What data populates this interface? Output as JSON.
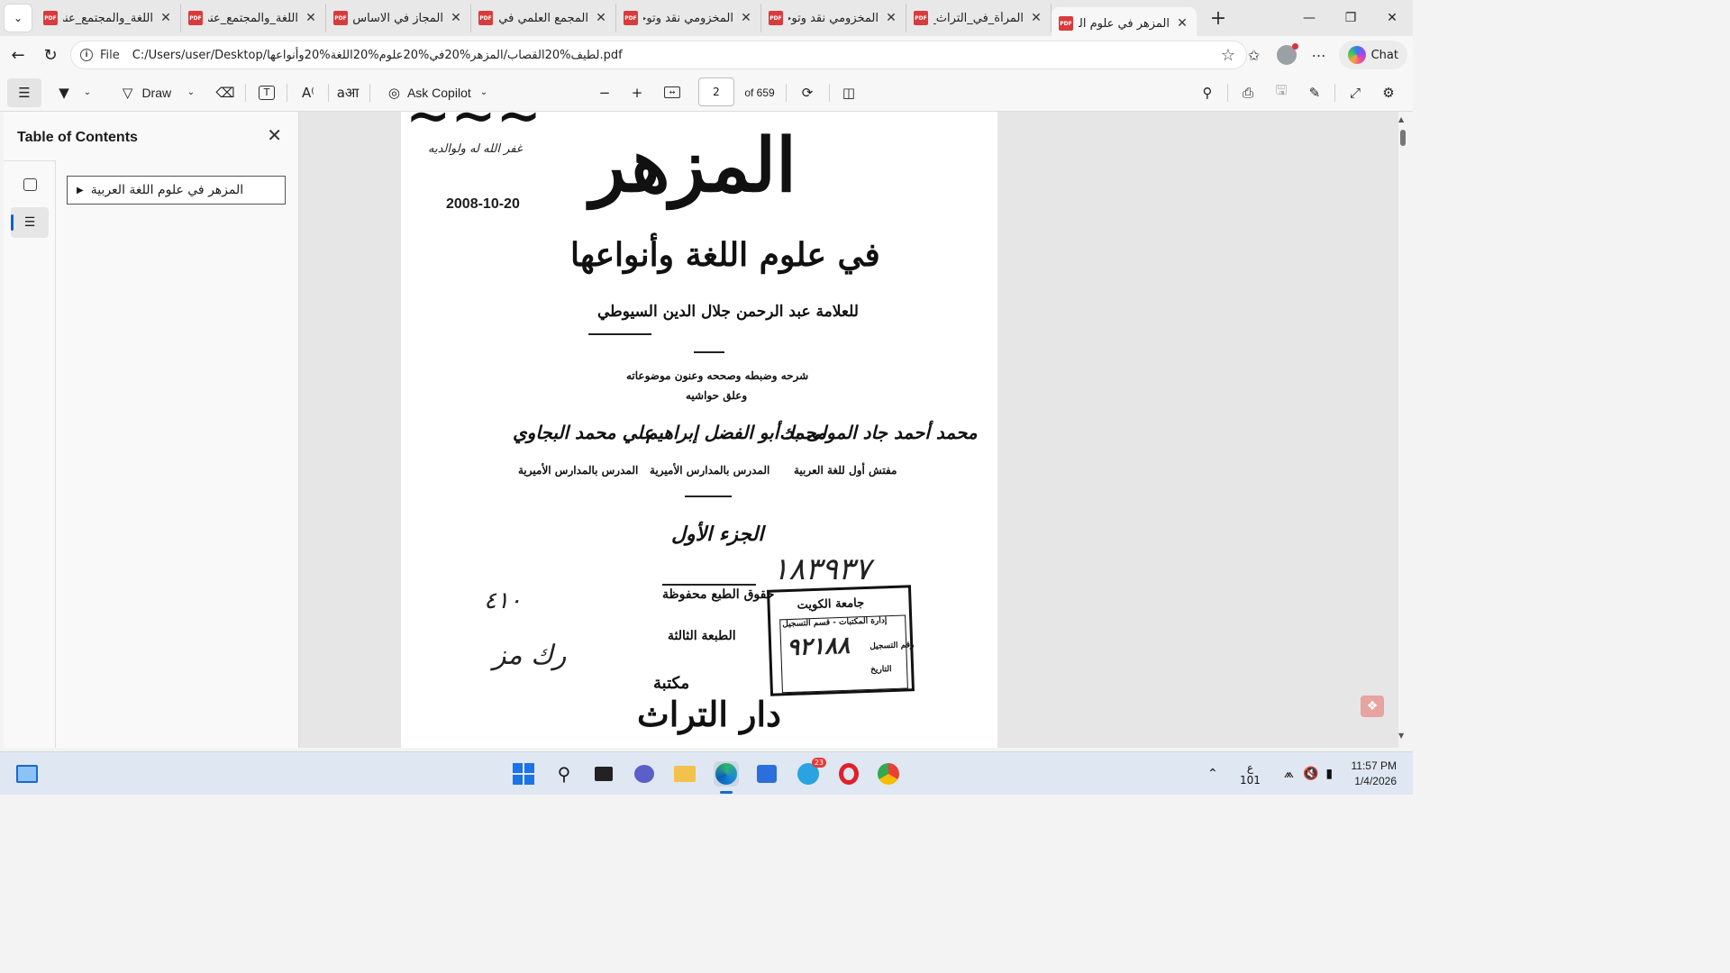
{
  "tabs": [
    {
      "title": "اللغة_والمجتمع_عند",
      "active": false
    },
    {
      "title": "اللغة_والمجتمع_عند",
      "active": false
    },
    {
      "title": "المجاز في الاساس.pdf",
      "active": false
    },
    {
      "title": "المجمع العلمي في ال",
      "active": false
    },
    {
      "title": "المخزومي نقد وتوجيه",
      "active": false
    },
    {
      "title": "المخزومي نقد وتوجيه",
      "active": false
    },
    {
      "title": "المرأة_في_التراث_الع",
      "active": false
    },
    {
      "title": "المزهر في علوم اللغ",
      "active": true
    }
  ],
  "address": {
    "scheme_label": "File",
    "url": "C:/Users/user/Desktop/لطيف%20القصاب/المزهر%20في%20علوم%20اللغة%20وأنواعها.pdf"
  },
  "chat_label": "Chat",
  "pdf_toolbar": {
    "draw_label": "Draw",
    "ask_copilot_label": "Ask Copilot",
    "page_current": "2",
    "page_total": "of 659"
  },
  "sidebar": {
    "title": "Table of Contents",
    "toc_items": [
      "المزهر في علوم اللغة العربية"
    ]
  },
  "page": {
    "title": "المزهر",
    "dedication": "غفر الله له ولوالديه",
    "date": "2008-10-20",
    "subtitle": "في علوم اللغة وأنواعها",
    "author": "للعلامة عبد الرحمن جلال الدين السيوطي",
    "editors_line1": "شرحه وضبطه وصححه وعنون موضوعاته",
    "editors_line2": "وعلق حواشيه",
    "editor1_name": "محمد أحمد جاد المولى بك",
    "editor1_role": "مفتش أول للغة العربية",
    "editor2_name": "محمد أبو الفضل إبراهيم",
    "editor2_role": "المدرس بالمدارس الأميرية",
    "editor3_name": "علي محمد البجاوي",
    "editor3_role": "المدرس بالمدارس الأميرية",
    "volume": "الجزء الأول",
    "handwritten_number": "١٨٣٩٣٧",
    "handwritten_note1": "٤١٠",
    "handwritten_note2": "رك مز",
    "copyright": "حقوق الطبع محفوظة",
    "edition": "الطبعة الثالثة",
    "stamp_university": "جامعة الكويت",
    "stamp_dept": "إدارة المكتبات - قسم التسجيل",
    "stamp_number": "٩٢١٨٨",
    "stamp_reg": "رقم التسجيل",
    "stamp_date": "التاريخ",
    "publisher_1": "مكتبة",
    "publisher_2": "دار التراث"
  },
  "taskbar": {
    "telegram_badge": "23",
    "lang_top": "ع",
    "lang_bottom": "101",
    "time": "11:57 PM",
    "date": "1/4/2026"
  }
}
